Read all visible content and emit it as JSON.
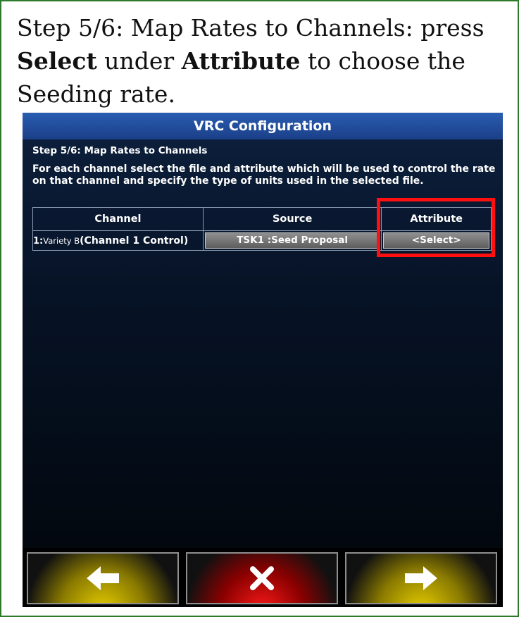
{
  "caption": {
    "prefix": "Step 5/6: Map Rates to Channels: press ",
    "bold1": "Select",
    "middle": " under ",
    "bold2": "Attribute",
    "suffix": " to choose the Seeding rate."
  },
  "window": {
    "title": "VRC Configuration"
  },
  "step": {
    "title": "Step 5/6: Map Rates to Channels",
    "description": "For each channel select the file and attribute which will be used to control the rate on that channel and specify the type of units used in the selected file."
  },
  "table": {
    "headers": [
      "Channel",
      "Source",
      "Attribute"
    ],
    "rows": [
      {
        "channel_prefix": "1:",
        "channel_name": "Variety B",
        "channel_control": "(Channel 1 Control)",
        "source": "TSK1 :Seed Proposal",
        "attribute": "<Select>"
      }
    ]
  },
  "colors": {
    "highlight": "#ff1010",
    "frame": "#2d7a2d",
    "titlebar": "#1b3f88"
  },
  "nav": {
    "back_icon": "left-arrow-icon",
    "cancel_icon": "x-icon",
    "next_icon": "right-arrow-icon"
  }
}
